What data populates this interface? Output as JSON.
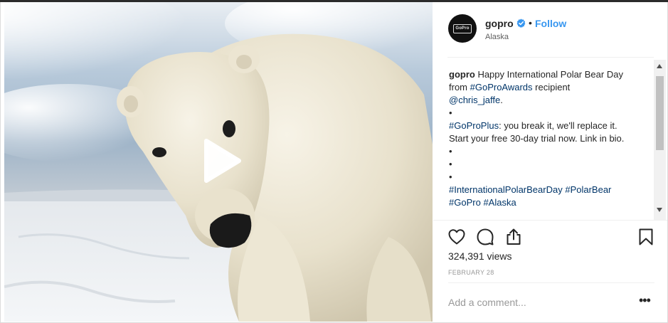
{
  "post": {
    "username": "gopro",
    "follow_label": "Follow",
    "separator": "•",
    "location": "Alaska",
    "avatar_logo_text": "GoPro",
    "icons": {
      "verified": "verified-badge-icon",
      "play": "play-icon",
      "like": "heart-icon",
      "comment": "comment-icon",
      "share": "share-icon",
      "save": "bookmark-icon",
      "more": "more-options-icon"
    },
    "colors": {
      "link": "#3897f0",
      "hashtag": "#003569",
      "verified": "#3897f0"
    }
  },
  "caption": {
    "user": "gopro",
    "parts": [
      " Happy International Polar Bear Day from ",
      "#GoProAwards",
      " recipient\n",
      "@chris_jaffe",
      ".\n•\n",
      "#GoProPlus",
      ": you break it, we'll replace it. Start your free 30-day trial now. Link in bio.\n•\n•\n•\n",
      "#InternationalPolarBearDay",
      " ",
      "#PolarBear",
      "\n",
      "#GoPro",
      " ",
      "#Alaska"
    ]
  },
  "stats": {
    "views": "324,391 views",
    "date": "FEBRUARY 28"
  },
  "comment": {
    "placeholder": "Add a comment...",
    "more_label": "•••"
  }
}
